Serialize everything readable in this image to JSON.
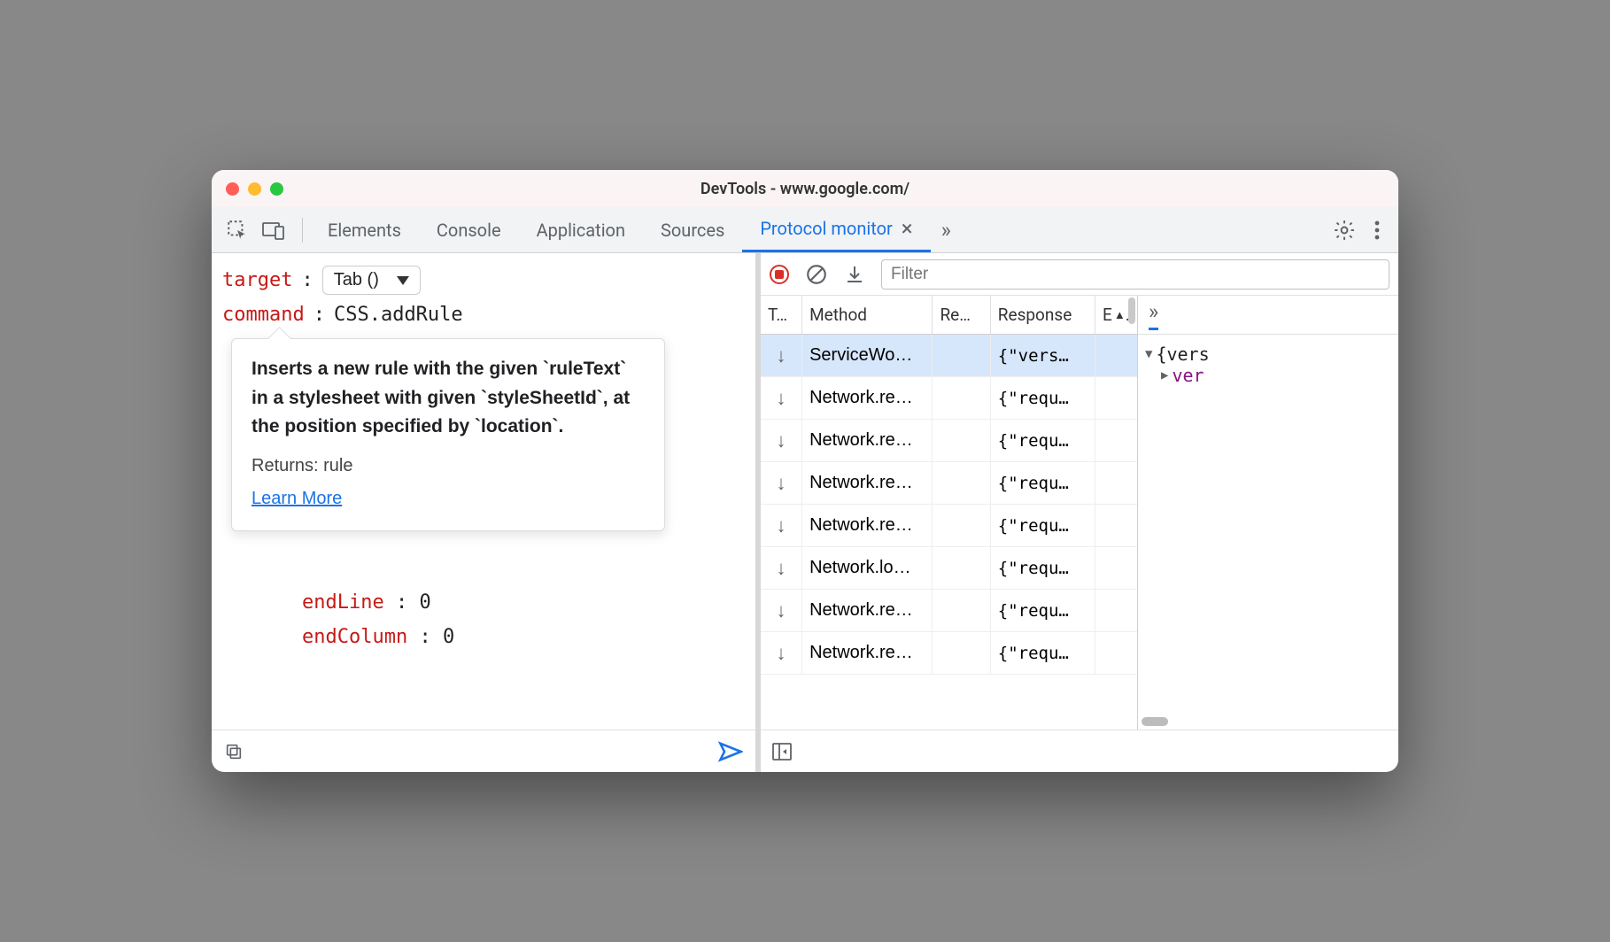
{
  "window_title": "DevTools - www.google.com/",
  "tabs": [
    "Elements",
    "Console",
    "Application",
    "Sources",
    "Protocol monitor"
  ],
  "active_tab_index": 4,
  "left": {
    "target_label": "target",
    "target_value": "Tab ()",
    "command_label": "command",
    "command_value": "CSS.addRule",
    "tooltip": {
      "description": "Inserts a new rule with the given `ruleText` in a stylesheet with given `styleSheetId`, at the position specified by `location`.",
      "returns": "Returns: rule",
      "learn_more": "Learn More"
    },
    "params": [
      {
        "key": "endLine",
        "value": "0"
      },
      {
        "key": "endColumn",
        "value": "0"
      }
    ]
  },
  "right": {
    "filter_placeholder": "Filter",
    "columns": {
      "t": "T…",
      "method": "Method",
      "re": "Re…",
      "response": "Response",
      "e": "E"
    },
    "rows": [
      {
        "direction": "↓",
        "method": "ServiceWo…",
        "re": "",
        "response": "{\"vers…",
        "e": "",
        "selected": true
      },
      {
        "direction": "↓",
        "method": "Network.re…",
        "re": "",
        "response": "{\"requ…",
        "e": ""
      },
      {
        "direction": "↓",
        "method": "Network.re…",
        "re": "",
        "response": "{\"requ…",
        "e": ""
      },
      {
        "direction": "↓",
        "method": "Network.re…",
        "re": "",
        "response": "{\"requ…",
        "e": ""
      },
      {
        "direction": "↓",
        "method": "Network.re…",
        "re": "",
        "response": "{\"requ…",
        "e": ""
      },
      {
        "direction": "↓",
        "method": "Network.lo…",
        "re": "",
        "response": "{\"requ…",
        "e": ""
      },
      {
        "direction": "↓",
        "method": "Network.re…",
        "re": "",
        "response": "{\"requ…",
        "e": ""
      },
      {
        "direction": "↓",
        "method": "Network.re…",
        "re": "",
        "response": "{\"requ…",
        "e": ""
      }
    ],
    "detail": {
      "root": "{vers",
      "child_key": "ver"
    }
  }
}
